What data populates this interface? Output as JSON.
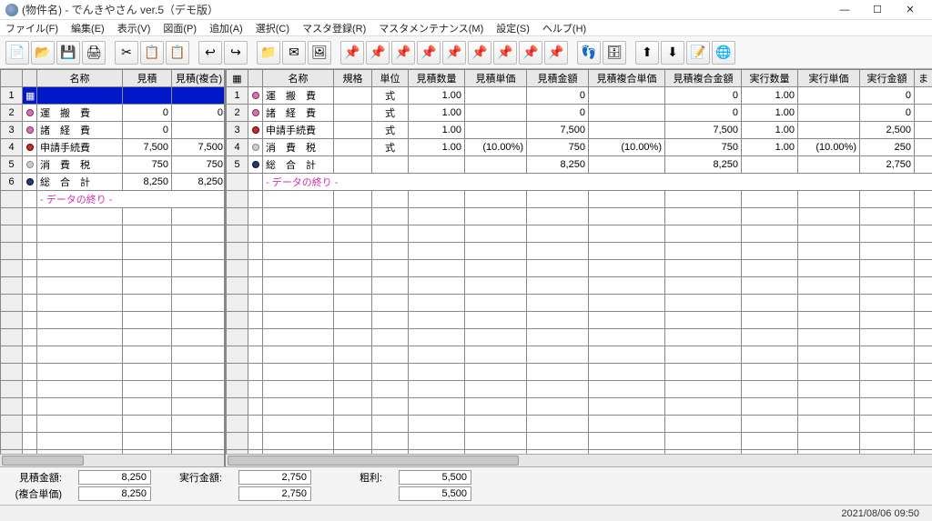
{
  "window": {
    "title": "(物件名) - でんきやさん ver.5（デモ版）"
  },
  "menu": [
    "ファイル(F)",
    "編集(E)",
    "表示(V)",
    "図面(P)",
    "追加(A)",
    "選択(C)",
    "マスタ登録(R)",
    "マスタメンテナンス(M)",
    "設定(S)",
    "ヘルプ(H)"
  ],
  "toolbar_icons": [
    "📄",
    "📂",
    "💾",
    "🖨",
    "✂",
    "📋",
    "📋",
    "↩",
    "↪",
    "📁",
    "✉",
    "🖼",
    "📌",
    "📌",
    "📌",
    "📌",
    "📌",
    "📌",
    "📌",
    "📌",
    "📌",
    "👣",
    "🗄",
    "⬆",
    "⬇",
    "📝",
    "🌐"
  ],
  "left": {
    "headers": [
      "",
      "",
      "名称",
      "見積",
      "見積(複合)"
    ],
    "rows": [
      {
        "n": "1",
        "sel": true,
        "icon": "",
        "name": "",
        "mitsumori": "",
        "fukugo": ""
      },
      {
        "n": "2",
        "icon": "pink",
        "name": "運　搬　費",
        "mitsumori": "0",
        "fukugo": "0"
      },
      {
        "n": "3",
        "icon": "pink",
        "name": "諸　経　費",
        "mitsumori": "0",
        "fukugo": ""
      },
      {
        "n": "4",
        "icon": "red",
        "name": "申請手続費",
        "mitsumori": "7,500",
        "fukugo": "7,500"
      },
      {
        "n": "5",
        "icon": "grey",
        "name": "消　費　税",
        "mitsumori": "750",
        "fukugo": "750"
      },
      {
        "n": "6",
        "icon": "navy",
        "name": "総　合　計",
        "mitsumori": "8,250",
        "fukugo": "8,250"
      }
    ],
    "data_end": "- データの終り -"
  },
  "right": {
    "headers": [
      "",
      "",
      "名称",
      "規格",
      "単位",
      "見積数量",
      "見積単価",
      "見積金額",
      "見積複合単価",
      "見積複合金額",
      "実行数量",
      "実行単価",
      "実行金額"
    ],
    "rows": [
      {
        "n": "1",
        "icon": "pink",
        "name": "運　搬　費",
        "spec": "",
        "unit": "式",
        "m_qty": "1.00",
        "m_unit": "",
        "m_amt": "0",
        "mf_unit": "",
        "mf_amt": "0",
        "r_qty": "1.00",
        "r_unit": "",
        "r_amt": "0"
      },
      {
        "n": "2",
        "icon": "pink",
        "name": "諸　経　費",
        "spec": "",
        "unit": "式",
        "m_qty": "1.00",
        "m_unit": "",
        "m_amt": "0",
        "mf_unit": "",
        "mf_amt": "0",
        "r_qty": "1.00",
        "r_unit": "",
        "r_amt": "0"
      },
      {
        "n": "3",
        "icon": "red",
        "name": "申請手続費",
        "spec": "",
        "unit": "式",
        "m_qty": "1.00",
        "m_unit": "",
        "m_amt": "7,500",
        "mf_unit": "",
        "mf_amt": "7,500",
        "r_qty": "1.00",
        "r_unit": "",
        "r_amt": "2,500"
      },
      {
        "n": "4",
        "icon": "grey",
        "name": "消　費　税",
        "spec": "",
        "unit": "式",
        "m_qty": "1.00",
        "m_unit": "(10.00%)",
        "m_amt": "750",
        "mf_unit": "(10.00%)",
        "mf_amt": "750",
        "r_qty": "1.00",
        "r_unit": "(10.00%)",
        "r_amt": "250"
      },
      {
        "n": "5",
        "icon": "navy",
        "name": "総　合　計",
        "spec": "",
        "unit": "",
        "m_qty": "",
        "m_unit": "",
        "m_amt": "8,250",
        "mf_unit": "",
        "mf_amt": "8,250",
        "r_qty": "",
        "r_unit": "",
        "r_amt": "2,750"
      }
    ],
    "data_end": "- データの終り -"
  },
  "footer": {
    "labels": {
      "mitsumori": "見積金額:",
      "jikkou": "実行金額:",
      "arari": "粗利:",
      "fukugo": "(複合単価)"
    },
    "vals": {
      "mitsumori": "8,250",
      "jikkou": "2,750",
      "arari": "5,500",
      "fukugo_m": "8,250",
      "fukugo_j": "2,750",
      "fukugo_a": "5,500"
    }
  },
  "status": {
    "datetime": "2021/08/06 09:50"
  }
}
